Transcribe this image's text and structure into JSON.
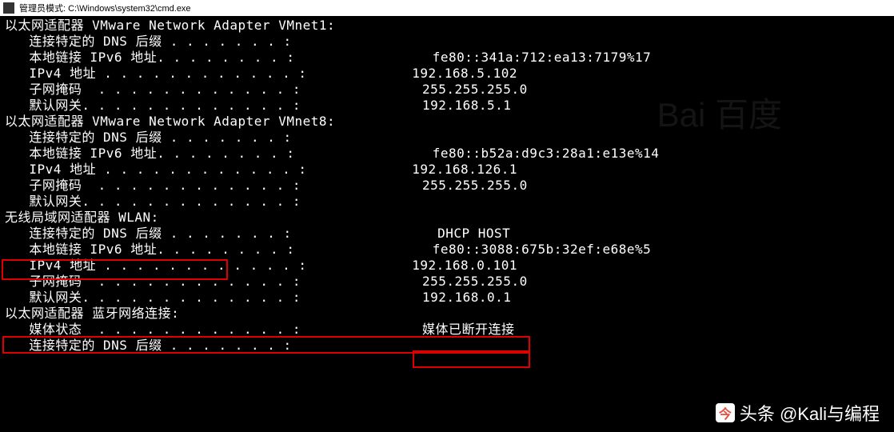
{
  "titleBar": {
    "text": "管理员模式: C:\\Windows\\system32\\cmd.exe"
  },
  "adapters": [
    {
      "header": "以太网适配器 VMware Network Adapter VMnet1:",
      "fields": [
        {
          "label": "连接特定的 DNS 后缀",
          "dots": " . . . . . . . :",
          "value": ""
        },
        {
          "label": "本地链接 IPv6 地址",
          "dots": ". . . . . . . . :",
          "value": "fe80::341a:712:ea13:7179%17"
        },
        {
          "label": "IPv4 地址",
          "dots": " . . . . . . . . . . . . :",
          "value": "192.168.5.102"
        },
        {
          "label": "子网掩码",
          "dots": "  . . . . . . . . . . . . :",
          "value": "255.255.255.0"
        },
        {
          "label": "默认网关",
          "dots": ". . . . . . . . . . . . . :",
          "value": "192.168.5.1"
        }
      ]
    },
    {
      "header": "以太网适配器 VMware Network Adapter VMnet8:",
      "fields": [
        {
          "label": "连接特定的 DNS 后缀",
          "dots": " . . . . . . . :",
          "value": ""
        },
        {
          "label": "本地链接 IPv6 地址",
          "dots": ". . . . . . . . :",
          "value": "fe80::b52a:d9c3:28a1:e13e%14"
        },
        {
          "label": "IPv4 地址",
          "dots": " . . . . . . . . . . . . :",
          "value": "192.168.126.1"
        },
        {
          "label": "子网掩码",
          "dots": "  . . . . . . . . . . . . :",
          "value": "255.255.255.0"
        },
        {
          "label": "默认网关",
          "dots": ". . . . . . . . . . . . . :",
          "value": ""
        }
      ]
    },
    {
      "header": "无线局域网适配器 WLAN:",
      "fields": [
        {
          "label": "连接特定的 DNS 后缀",
          "dots": " . . . . . . . :",
          "value": "DHCP HOST"
        },
        {
          "label": "本地链接 IPv6 地址",
          "dots": ". . . . . . . . :",
          "value": "fe80::3088:675b:32ef:e68e%5"
        },
        {
          "label": "IPv4 地址",
          "dots": " . . . . . . . . . . . . :",
          "value": "192.168.0.101"
        },
        {
          "label": "子网掩码",
          "dots": "  . . . . . . . . . . . . :",
          "value": "255.255.255.0"
        },
        {
          "label": "默认网关",
          "dots": ". . . . . . . . . . . . . :",
          "value": "192.168.0.1"
        }
      ]
    },
    {
      "header": "以太网适配器 蓝牙网络连接:",
      "fields": [
        {
          "label": "媒体状态",
          "dots": "  . . . . . . . . . . . . :",
          "value": "媒体已断开连接"
        },
        {
          "label": "连接特定的 DNS 后缀",
          "dots": " . . . . . . . :",
          "value": ""
        }
      ]
    }
  ],
  "watermark": {
    "text": "头条 @Kali与编程",
    "bgText": "Bai 百度"
  }
}
